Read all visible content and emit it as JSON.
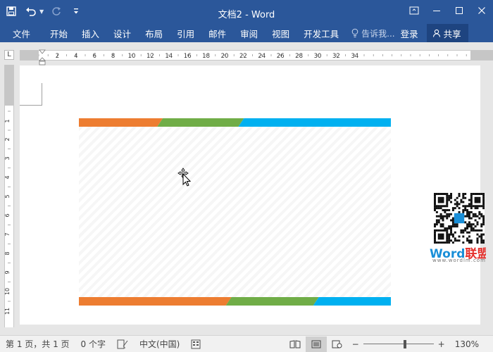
{
  "window": {
    "title": "文档2 - Word",
    "qat": {
      "save_icon": "save-icon",
      "undo_icon": "undo-icon",
      "redo_icon": "redo-icon",
      "customize_icon": "customize-qat-icon"
    },
    "controls": {
      "restore_ribbon": "ribbon-display-icon",
      "minimize": "minimize-icon",
      "maximize": "maximize-icon",
      "close": "close-icon"
    }
  },
  "ribbon": {
    "tabs": [
      "文件",
      "开始",
      "插入",
      "设计",
      "布局",
      "引用",
      "邮件",
      "审阅",
      "视图",
      "开发工具"
    ],
    "tell_me": "告诉我...",
    "login": "登录",
    "share": "共享"
  },
  "ruler": {
    "corner": "L",
    "h_labels": [
      "2",
      "2",
      "4",
      "6",
      "8",
      "10",
      "12",
      "14",
      "16",
      "18",
      "20",
      "22",
      "24",
      "26",
      "28",
      "30",
      "32",
      "34"
    ],
    "v_labels": [
      "2",
      "1",
      "1",
      "1",
      "2",
      "3",
      "4",
      "5",
      "6",
      "7",
      "8",
      "9",
      "10",
      "11"
    ]
  },
  "document": {
    "card_top_bar": [
      {
        "color": "#ed7d31",
        "from": 0.0,
        "to": 0.26
      },
      {
        "color": "#70ad47",
        "from": 0.26,
        "to": 0.52
      },
      {
        "color": "#00b0f0",
        "from": 0.52,
        "to": 1.0
      }
    ],
    "card_bottom_bar": [
      {
        "color": "#ed7d31",
        "from": 0.0,
        "to": 0.48
      },
      {
        "color": "#70ad47",
        "from": 0.48,
        "to": 0.76
      },
      {
        "color": "#00b0f0",
        "from": 0.76,
        "to": 1.0
      }
    ]
  },
  "watermark": {
    "logo_word": "Word",
    "logo_cn": "联盟",
    "url": "www.wordlm.com"
  },
  "status": {
    "page": "第 1 页，共 1 页",
    "words": "0 个字",
    "language": "中文(中国)",
    "zoom_minus": "−",
    "zoom_plus": "+",
    "zoom": "130%",
    "zoom_level": 0.6
  },
  "colors": {
    "accent": "#2b579a",
    "share_bg": "#1e4480"
  }
}
